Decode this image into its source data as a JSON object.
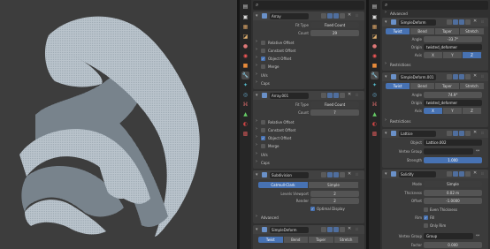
{
  "panel1": {
    "array1": {
      "name": "Array",
      "fit_type_label": "Fit Type",
      "fit_type": "Fixed Count",
      "count_label": "Count",
      "count": "29",
      "relative_offset": "Relative Offset",
      "constant_offset": "Constant Offset",
      "object_offset": "Object Offset",
      "merge": "Merge",
      "uvs": "UVs",
      "caps": "Caps"
    },
    "array2": {
      "name": "Array.001",
      "fit_type_label": "Fit Type",
      "fit_type": "Fixed Count",
      "count_label": "Count",
      "count": "7",
      "relative_offset": "Relative Offset",
      "constant_offset": "Constant Offset",
      "object_offset": "Object Offset",
      "merge": "Merge",
      "uvs": "UVs",
      "caps": "Caps"
    },
    "subdiv": {
      "name": "Subdivision",
      "tab_catmull": "Catmull-Clark",
      "tab_simple": "Simple",
      "levels_viewport_label": "Levels Viewport",
      "levels_viewport": "2",
      "render_label": "Render",
      "render": "2",
      "optimal_display": "Optimal Display",
      "advanced": "Advanced"
    },
    "simple_deform": {
      "name": "SimpleDeform",
      "tabs": [
        "Twist",
        "Bend",
        "Taper",
        "Stretch"
      ]
    }
  },
  "panel2": {
    "advanced": "Advanced",
    "deform1": {
      "name": "SimpleDeform",
      "tabs": [
        "Twist",
        "Bend",
        "Taper",
        "Stretch"
      ],
      "angle_label": "Angle",
      "angle": "-33.7°",
      "origin_label": "Origin",
      "origin": "twisted_deformer",
      "axis_label": "Axis",
      "axes": [
        "X",
        "Y",
        "Z"
      ],
      "restrictions": "Restrictions"
    },
    "deform2": {
      "name": "SimpleDeform.001",
      "tabs": [
        "Twist",
        "Bend",
        "Taper",
        "Stretch"
      ],
      "angle_label": "Angle",
      "angle": "74.9°",
      "origin_label": "Origin",
      "origin": "twisted_deformer",
      "axis_label": "Axis",
      "axes": [
        "X",
        "Y",
        "Z"
      ],
      "restrictions": "Restrictions"
    },
    "lattice": {
      "name": "Lattice",
      "object_label": "Object",
      "object": "Lattice.002",
      "vertex_group_label": "Vertex Group",
      "strength_label": "Strength",
      "strength": "1.000"
    },
    "solidify": {
      "name": "Solidify",
      "mode_label": "Mode",
      "mode": "Simple",
      "thickness_label": "Thickness",
      "thickness": "0.02 m",
      "offset_label": "Offset",
      "offset": "-1.0000",
      "even_thickness": "Even Thickness",
      "rim_label": "Rim",
      "fill": "Fill",
      "only_rim": "Only Rim",
      "vertex_group_label": "Vertex Group",
      "vertex_group": "Group",
      "factor_label": "Factor",
      "factor": "0.000"
    }
  }
}
